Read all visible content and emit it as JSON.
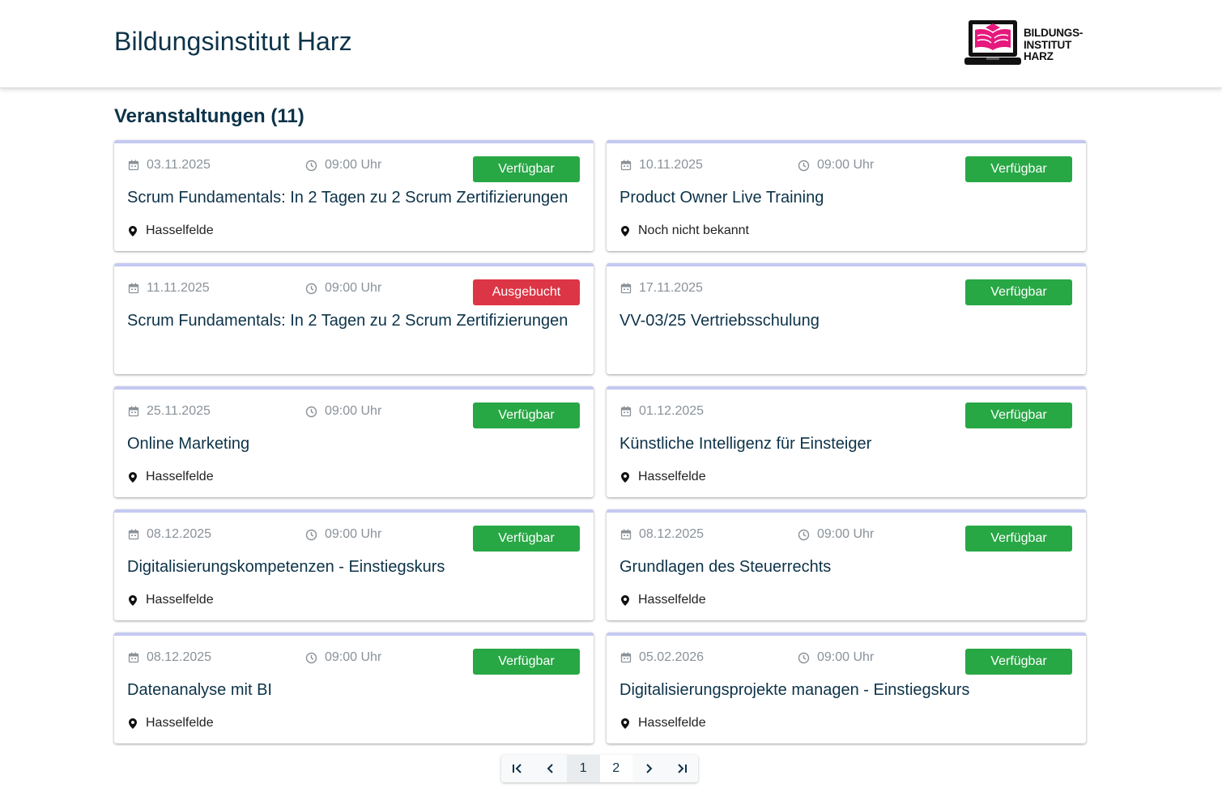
{
  "header": {
    "title": "Bildungsinstitut Harz"
  },
  "logo": {
    "line1": "BILDUNGS-",
    "line2": "INSTITUT",
    "line3": "HARZ"
  },
  "section": {
    "title": "Veranstaltungen (11)"
  },
  "colors": {
    "primary_text": "#0d3349",
    "available": "#28a745",
    "booked": "#dc3545",
    "card_accent": "#c4c9f2",
    "logo_pink": "#e6197d"
  },
  "events": [
    {
      "date": "03.11.2025",
      "time": "09:00 Uhr",
      "status": "Verfügbar",
      "title": "Scrum Fundamentals: In 2 Tagen zu 2 Scrum Zertifizierungen",
      "location": "Hasselfelde"
    },
    {
      "date": "10.11.2025",
      "time": "09:00 Uhr",
      "status": "Verfügbar",
      "title": "Product Owner Live Training",
      "location": "Noch nicht bekannt"
    },
    {
      "date": "11.11.2025",
      "time": "09:00 Uhr",
      "status": "Ausgebucht",
      "title": "Scrum Fundamentals: In 2 Tagen zu 2 Scrum Zertifizierungen",
      "location": ""
    },
    {
      "date": "17.11.2025",
      "time": "",
      "status": "Verfügbar",
      "title": "VV-03/25 Vertriebsschulung",
      "location": ""
    },
    {
      "date": "25.11.2025",
      "time": "09:00 Uhr",
      "status": "Verfügbar",
      "title": "Online Marketing",
      "location": "Hasselfelde"
    },
    {
      "date": "01.12.2025",
      "time": "",
      "status": "Verfügbar",
      "title": "Künstliche Intelligenz für Einsteiger",
      "location": "Hasselfelde"
    },
    {
      "date": "08.12.2025",
      "time": "09:00 Uhr",
      "status": "Verfügbar",
      "title": "Digitalisierungskompetenzen - Einstiegskurs",
      "location": "Hasselfelde"
    },
    {
      "date": "08.12.2025",
      "time": "09:00 Uhr",
      "status": "Verfügbar",
      "title": "Grundlagen des Steuerrechts",
      "location": "Hasselfelde"
    },
    {
      "date": "08.12.2025",
      "time": "09:00 Uhr",
      "status": "Verfügbar",
      "title": "Datenanalyse mit BI",
      "location": "Hasselfelde"
    },
    {
      "date": "05.02.2026",
      "time": "09:00 Uhr",
      "status": "Verfügbar",
      "title": "Digitalisierungsprojekte managen - Einstiegskurs",
      "location": "Hasselfelde"
    }
  ],
  "pagination": {
    "pages": [
      "1",
      "2"
    ],
    "current": "1"
  }
}
